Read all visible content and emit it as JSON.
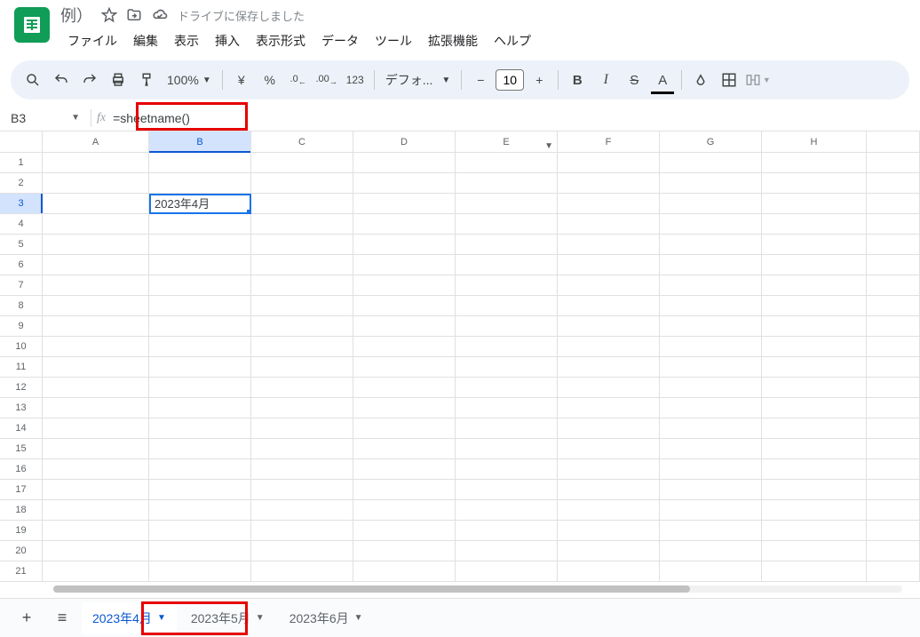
{
  "header": {
    "title": "例）",
    "save_status": "ドライブに保存しました",
    "menu": [
      "ファイル",
      "編集",
      "表示",
      "挿入",
      "表示形式",
      "データ",
      "ツール",
      "拡張機能",
      "ヘルプ"
    ]
  },
  "toolbar": {
    "zoom": "100%",
    "currency": "¥",
    "percent": "%",
    "numfmt": "123",
    "font": "デフォ...",
    "fontsize": "10",
    "bold": "B",
    "italic": "I",
    "strike": "S",
    "textA": "A"
  },
  "formula_bar": {
    "cell_ref": "B3",
    "fx": "fx",
    "formula": "=sheetname()"
  },
  "columns": [
    "A",
    "B",
    "C",
    "D",
    "E",
    "F",
    "G",
    "H"
  ],
  "selected_col_index": 1,
  "filter_col_index": 4,
  "rows": 21,
  "selected_row": 3,
  "cells": {
    "B3": "2023年4月"
  },
  "tabs": {
    "active": "2023年4月",
    "items": [
      "2023年4月",
      "2023年5月",
      "2023年6月"
    ]
  }
}
